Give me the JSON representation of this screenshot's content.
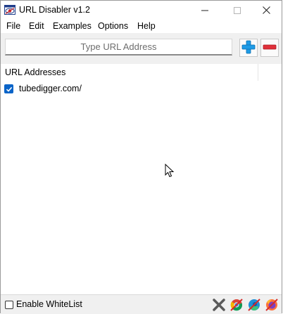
{
  "window": {
    "title": "URL Disabler v1.2",
    "controls": {
      "minimize": "minimize",
      "maximize": "maximize",
      "close": "close"
    }
  },
  "menu": [
    "File",
    "Edit",
    "Examples",
    "Options",
    "Help"
  ],
  "toolbar": {
    "url_placeholder": "Type URL Address",
    "add_icon": "plus-icon",
    "remove_icon": "minus-icon"
  },
  "list": {
    "header": "URL Addresses",
    "items": [
      {
        "label": "tubedigger.com/",
        "checked": true
      }
    ]
  },
  "statusbar": {
    "whitelist_label": "Enable WhiteList",
    "whitelist_checked": false,
    "icons": [
      "close-x-icon",
      "chrome-icon",
      "edge-icon",
      "firefox-icon"
    ]
  },
  "colors": {
    "accent_blue": "#0a64c8",
    "plus_blue": "#1e9be6",
    "minus_red": "#e0303a"
  }
}
